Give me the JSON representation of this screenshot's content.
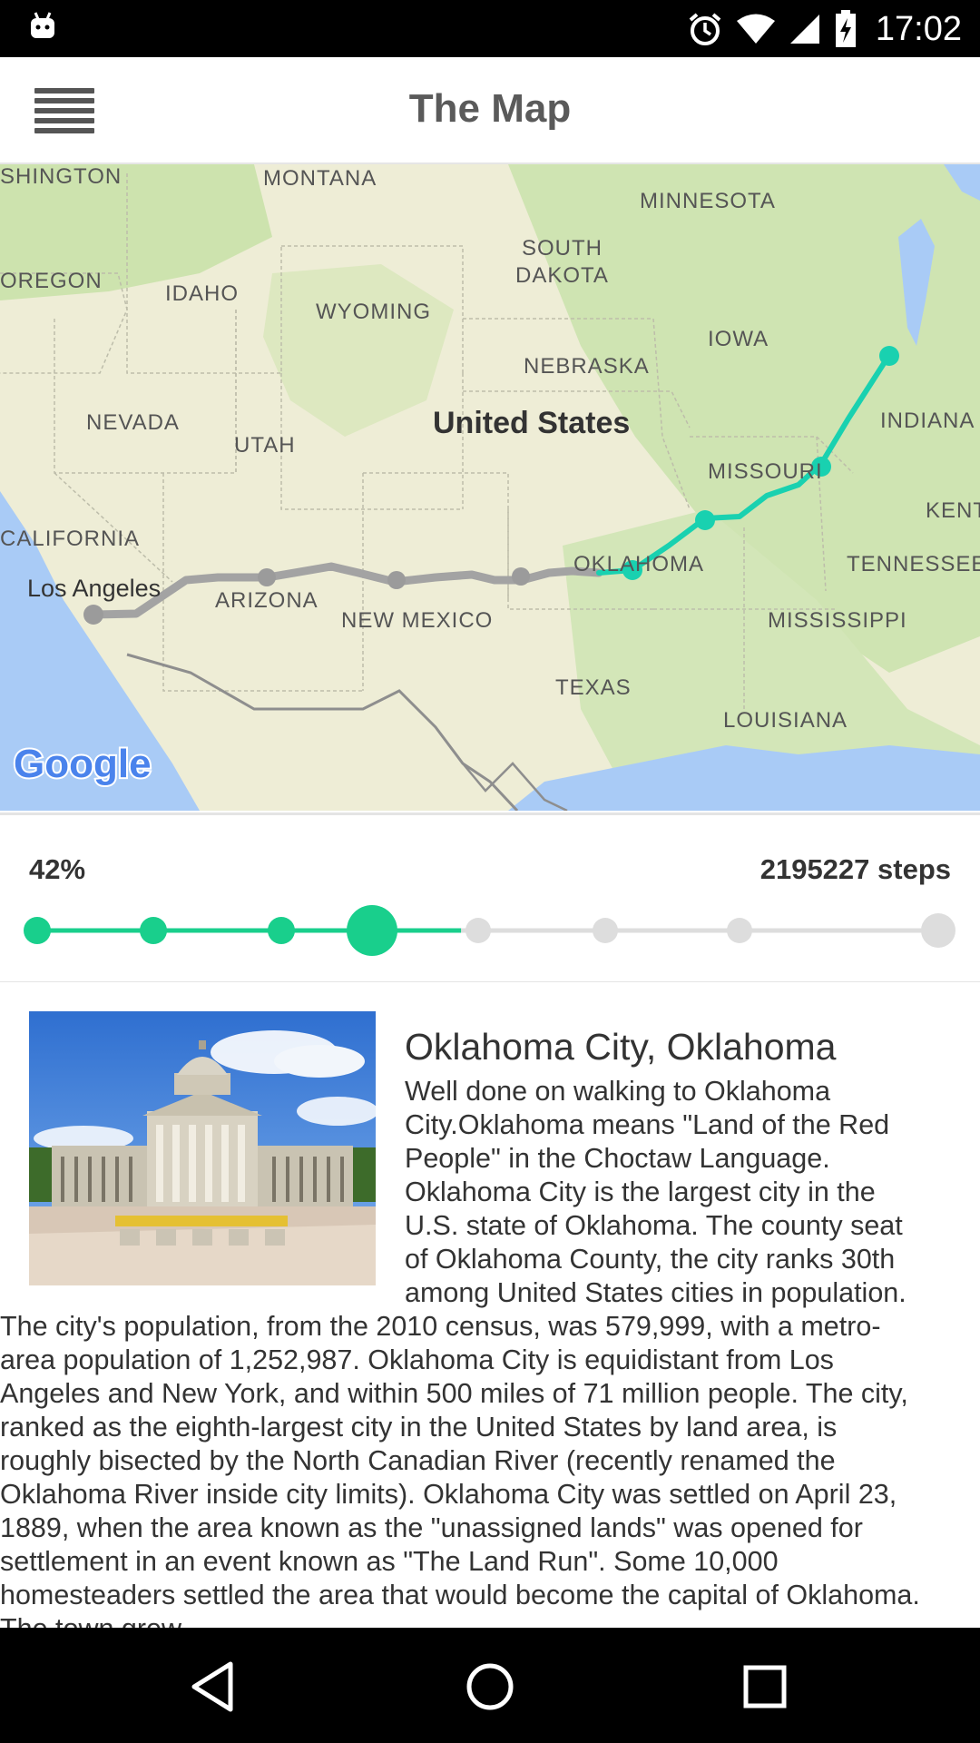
{
  "status_bar": {
    "time": "17:02",
    "icons": [
      "android-icon",
      "alarm-icon",
      "wifi-icon",
      "signal-icon",
      "battery-charging-icon"
    ]
  },
  "app_bar": {
    "title": "The Map",
    "menu_icon": "menu-icon"
  },
  "map": {
    "attribution": "Google",
    "labels": {
      "washington": "SHINGTON",
      "montana": "MONTANA",
      "minnesota": "MINNESOTA",
      "south_dakota_1": "SOUTH",
      "south_dakota_2": "DAKOTA",
      "oregon": "OREGON",
      "idaho": "IDAHO",
      "wyoming": "WYOMING",
      "iowa": "IOWA",
      "nebraska": "NEBRASKA",
      "nevada": "NEVADA",
      "utah": "UTAH",
      "united_states": "United States",
      "indiana": "INDIANA",
      "missouri": "MISSOURI",
      "kentucky": "KENTUC",
      "california": "CALIFORNIA",
      "oklahoma": "OKLAHOMA",
      "tennessee": "TENNESSEE",
      "los_angeles": "Los Angeles",
      "arizona": "ARIZONA",
      "new_mexico": "NEW MEXICO",
      "mississippi": "MISSISSIPPI",
      "texas": "TEXAS",
      "louisiana": "LOUISIANA"
    },
    "colors": {
      "land": "#efeed8",
      "water": "#a9cbf6",
      "green": "#c8e2a8",
      "route_done": "#a3a3a3",
      "route_upcoming": "#19d1b0"
    }
  },
  "progress": {
    "percent_label": "42%",
    "percent_value": 0.42,
    "steps_label": "2195227 steps",
    "milestones_total": 8,
    "milestones_reached": 4,
    "accent": "#19cf8c",
    "inactive": "#dddddd"
  },
  "landmark": {
    "title": "Oklahoma City, Oklahoma",
    "description": "Well done on walking to Oklahoma City.Oklahoma means \"Land of the Red People\" in the Choctaw Language. Oklahoma City is the largest city in the U.S. state of Oklahoma. The county seat of Oklahoma County, the city ranks 30th among United States cities in population. The city's population, from the 2010 census, was 579,999, with a metro-area population of 1,252,987. Oklahoma City is equidistant from Los Angeles and New York, and within 500 miles of 71 million people. The city, ranked as the eighth-largest city in the United States by land area, is roughly bisected by the North Canadian River (recently renamed the Oklahoma River inside city limits). Oklahoma City was settled on April 23, 1889, when the area known as the \"unassigned lands\" was opened for settlement in an event known as \"The Land Run\". Some 10,000 homesteaders settled the area that would become the capital of Oklahoma. The town grew"
  },
  "nav_bar": {
    "back": "back-icon",
    "home": "home-icon",
    "recents": "recents-icon"
  }
}
